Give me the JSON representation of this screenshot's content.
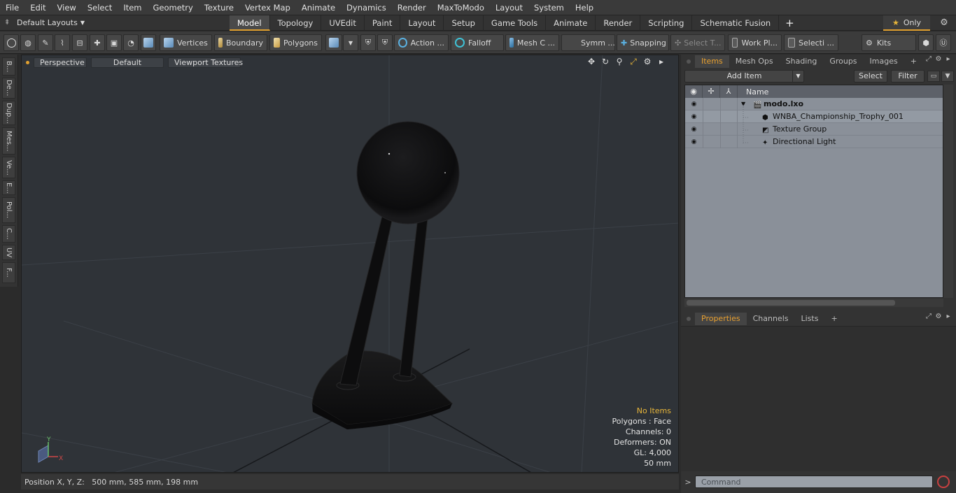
{
  "menu": [
    "File",
    "Edit",
    "View",
    "Select",
    "Item",
    "Geometry",
    "Texture",
    "Vertex Map",
    "Animate",
    "Dynamics",
    "Render",
    "MaxToModo",
    "Layout",
    "System",
    "Help"
  ],
  "layout_dropdown": "Default Layouts",
  "tabs": [
    {
      "label": "Model",
      "active": true
    },
    {
      "label": "Topology"
    },
    {
      "label": "UVEdit"
    },
    {
      "label": "Paint"
    },
    {
      "label": "Layout"
    },
    {
      "label": "Setup"
    },
    {
      "label": "Game Tools"
    },
    {
      "label": "Animate"
    },
    {
      "label": "Render"
    },
    {
      "label": "Scripting"
    },
    {
      "label": "Schematic Fusion"
    }
  ],
  "tab_add": "+",
  "only_label": "Only",
  "toolbar": {
    "vertices": "Vertices",
    "boundary": "Boundary",
    "polygons": "Polygons",
    "action": "Action ...",
    "falloff": "Falloff",
    "mesh": "Mesh C ...",
    "symm": "Symm ...",
    "snapping": "Snapping",
    "select_t": "Select T...",
    "work_plane": "Work Pl...",
    "selecti": "Selecti ...",
    "kits": "Kits"
  },
  "left_tabs": [
    "B...",
    "De...",
    "Dup...",
    "Mes...",
    "Ve...",
    "E...",
    "Pol...",
    "C...",
    "UV",
    "F..."
  ],
  "viewport": {
    "view_mode": "Perspective",
    "shading": "Default",
    "textures": "Viewport Textures",
    "axis_x": "X",
    "axis_y": "Y",
    "info": {
      "selection": "No Items",
      "polygons": "Polygons : Face",
      "channels": "Channels: 0",
      "deformers": "Deformers: ON",
      "gl": "GL: 4,000",
      "grid": "50 mm"
    }
  },
  "status": "Position X, Y, Z:   500 mm, 585 mm, 198 mm",
  "items_panel": {
    "tabs": [
      {
        "label": "Items",
        "active": true
      },
      {
        "label": "Mesh Ops"
      },
      {
        "label": "Shading"
      },
      {
        "label": "Groups"
      },
      {
        "label": "Images"
      }
    ],
    "add_item": "Add Item",
    "select": "Select",
    "filter": "Filter",
    "column_name": "Name",
    "rows": [
      {
        "label": "modo.lxo",
        "bold": true,
        "icon": "scene-icon"
      },
      {
        "label": "WNBA_Championship_Trophy_001",
        "icon": "mesh-icon",
        "selected": true
      },
      {
        "label": "Texture Group",
        "icon": "texture-group-icon"
      },
      {
        "label": "Directional Light",
        "icon": "light-icon"
      }
    ]
  },
  "props_panel": {
    "tabs": [
      {
        "label": "Properties",
        "active": true
      },
      {
        "label": "Channels"
      },
      {
        "label": "Lists"
      }
    ]
  },
  "command_placeholder": "Command",
  "colors": {
    "accent": "#e8a030",
    "viewport_bg": "#2f3338",
    "list_bg": "#8a9099"
  }
}
